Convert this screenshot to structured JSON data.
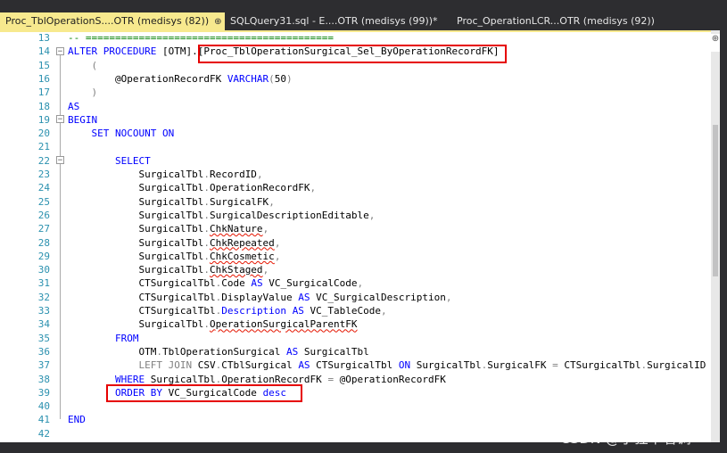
{
  "tabs": [
    {
      "label": "Proc_TblOperationS....OTR (medisys (82))",
      "active": true,
      "pin": "⊕",
      "close": "×"
    },
    {
      "label": "SQLQuery31.sql - E....OTR (medisys (99))*",
      "active": false
    },
    {
      "label": "Proc_OperationLCR...OTR (medisys (92))",
      "active": false
    }
  ],
  "lines": [
    {
      "n": "13",
      "html": "<span class=\"cmt\">-- ==========================================</span>"
    },
    {
      "n": "14",
      "html": "<span class=\"kw\">ALTER PROCEDURE</span> [OTM].[Proc_TblOperationSurgical_Sel_ByOperationRecordFK]"
    },
    {
      "n": "15",
      "html": "    <span class=\"gray\">(</span>"
    },
    {
      "n": "16",
      "html": "        @OperationRecordFK <span class=\"kw\">VARCHAR</span><span class=\"gray\">(</span>50<span class=\"gray\">)</span>"
    },
    {
      "n": "17",
      "html": "    <span class=\"gray\">)</span>"
    },
    {
      "n": "18",
      "html": "<span class=\"kw\">AS</span>"
    },
    {
      "n": "19",
      "html": "<span class=\"kw\">BEGIN</span>"
    },
    {
      "n": "20",
      "html": "    <span class=\"kw\">SET NOCOUNT ON</span>"
    },
    {
      "n": "21",
      "html": ""
    },
    {
      "n": "22",
      "html": "        <span class=\"kw\">SELECT</span>"
    },
    {
      "n": "23",
      "html": "            SurgicalTbl<span class=\"gray\">.</span>RecordID<span class=\"gray\">,</span>"
    },
    {
      "n": "24",
      "html": "            SurgicalTbl<span class=\"gray\">.</span>OperationRecordFK<span class=\"gray\">,</span>"
    },
    {
      "n": "25",
      "html": "            SurgicalTbl<span class=\"gray\">.</span>SurgicalFK<span class=\"gray\">,</span>"
    },
    {
      "n": "26",
      "html": "            SurgicalTbl<span class=\"gray\">.</span>SurgicalDescriptionEditable<span class=\"gray\">,</span>"
    },
    {
      "n": "27",
      "html": "            SurgicalTbl<span class=\"gray\">.</span><span class=\"squig\">ChkNature</span><span class=\"gray\">,</span>"
    },
    {
      "n": "28",
      "html": "            SurgicalTbl<span class=\"gray\">.</span><span class=\"squig\">ChkRepeated</span><span class=\"gray\">,</span>"
    },
    {
      "n": "29",
      "html": "            SurgicalTbl<span class=\"gray\">.</span><span class=\"squig\">ChkCosmetic</span><span class=\"gray\">,</span>"
    },
    {
      "n": "30",
      "html": "            SurgicalTbl<span class=\"gray\">.</span><span class=\"squig\">ChkStaged</span><span class=\"gray\">,</span>"
    },
    {
      "n": "31",
      "html": "            CTSurgicalTbl<span class=\"gray\">.</span>Code <span class=\"kw\">AS</span> VC_SurgicalCode<span class=\"gray\">,</span>"
    },
    {
      "n": "32",
      "html": "            CTSurgicalTbl<span class=\"gray\">.</span>DisplayValue <span class=\"kw\">AS</span> VC_SurgicalDescription<span class=\"gray\">,</span>"
    },
    {
      "n": "33",
      "html": "            CTSurgicalTbl<span class=\"gray\">.</span><span class=\"kw\">Description</span> <span class=\"kw\">AS</span> VC_TableCode<span class=\"gray\">,</span>"
    },
    {
      "n": "34",
      "html": "            SurgicalTbl<span class=\"gray\">.</span><span class=\"squig\">OperationSurgicalParentFK</span>"
    },
    {
      "n": "35",
      "html": "        <span class=\"kw\">FROM</span>"
    },
    {
      "n": "36",
      "html": "            OTM<span class=\"gray\">.</span>TblOperationSurgical <span class=\"kw\">AS</span> SurgicalTbl"
    },
    {
      "n": "37",
      "html": "            <span class=\"gray\">LEFT JOIN</span> CSV<span class=\"gray\">.</span>CTblSurgical <span class=\"kw\">AS</span> CTSurgicalTbl <span class=\"kw\">ON</span> SurgicalTbl<span class=\"gray\">.</span>SurgicalFK <span class=\"gray\">=</span> CTSurgicalTbl<span class=\"gray\">.</span>SurgicalID"
    },
    {
      "n": "38",
      "html": "        <span class=\"kw\">WHERE</span> SurgicalTbl<span class=\"gray\">.</span>OperationRecordFK <span class=\"gray\">=</span> @OperationRecordFK"
    },
    {
      "n": "39",
      "html": "        <span class=\"kw\">ORDER BY</span> VC_SurgicalCode <span class=\"kw\">desc</span>"
    },
    {
      "n": "40",
      "html": ""
    },
    {
      "n": "41",
      "html": "<span class=\"kw\">END</span>"
    },
    {
      "n": "42",
      "html": ""
    }
  ],
  "watermark": "CSDN @小狂不着调",
  "split_icon": "⊕",
  "colors": {
    "active_tab": "#f7e98e",
    "keyword": "#0000ff",
    "line_number": "#2b91af",
    "highlight_box": "#e60000",
    "background": "#2d2d30"
  }
}
